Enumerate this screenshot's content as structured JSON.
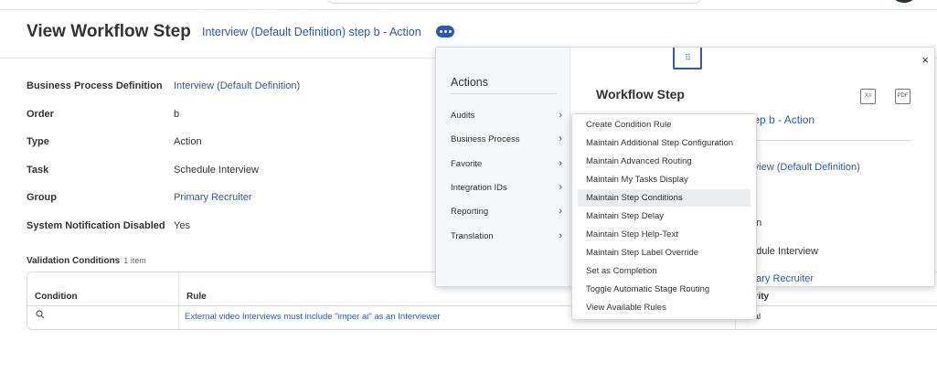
{
  "page": {
    "title": "View Workflow Step",
    "subtitle": "Interview (Default Definition) step b - Action"
  },
  "fields": [
    {
      "label": "Business Process Definition",
      "value": "Interview (Default Definition)"
    },
    {
      "label": "Order",
      "value": "b"
    },
    {
      "label": "Type",
      "value": "Action"
    },
    {
      "label": "Task",
      "value": "Schedule Interview"
    },
    {
      "label": "Group",
      "value": "Primary Recruiter"
    },
    {
      "label": "System Notification Disabled",
      "value": "Yes"
    }
  ],
  "validation": {
    "title": "Validation Conditions",
    "count": "1 item",
    "columns": [
      "Condition",
      "Rule",
      "erity"
    ],
    "row": {
      "condition_icon": "search-icon",
      "rule": "External video Interviews must include \"imper ai\" as an Interviewer",
      "severity": "cal"
    }
  },
  "actions_panel": {
    "title": "Actions",
    "items": [
      "Audits",
      "Business Process",
      "Favorite",
      "Integration IDs",
      "Reporting",
      "Translation"
    ]
  },
  "preview": {
    "title": "Workflow Step",
    "close": "×",
    "grip": "⠿",
    "xls": "X≡",
    "pdf": "PDF",
    "subtitle_fragment": "tep b - Action",
    "fragments": [
      "rview (Default Definition)",
      "on",
      "edule Interview",
      "nary Recruiter"
    ]
  },
  "submenu": {
    "items": [
      "Create Condition Rule",
      "Maintain Additional Step Configuration",
      "Maintain Advanced Routing",
      "Maintain My Tasks Display",
      "Maintain Step Conditions",
      "Maintain Step Delay",
      "Maintain Step Help-Text",
      "Maintain Step Label Override",
      "Set as Completion",
      "Toggle Automatic Stage Routing",
      "View Available Rules"
    ],
    "highlighted": "Maintain Step Conditions"
  },
  "colors": {
    "link": "#2e5aa6",
    "highlight": "#ebedef"
  }
}
